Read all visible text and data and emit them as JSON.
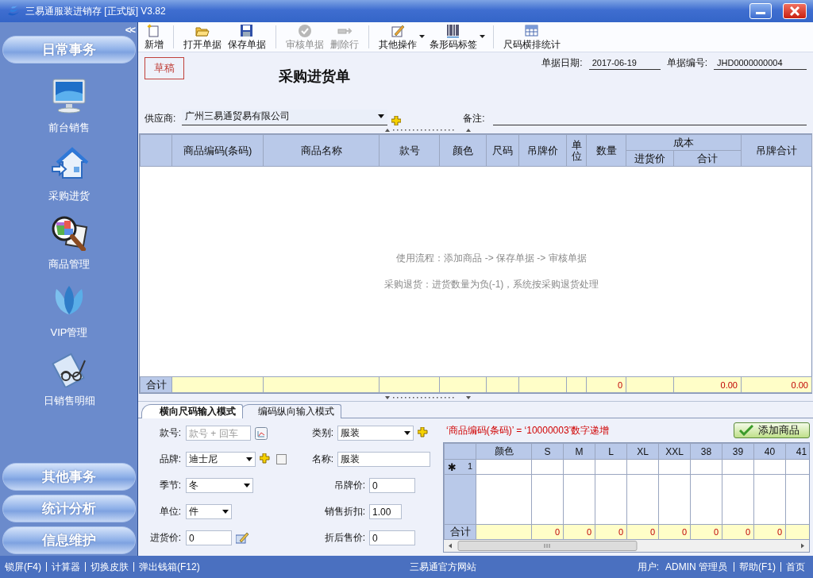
{
  "window": {
    "title": "三易通服装进销存 [正式版] V3.82"
  },
  "sidebar": {
    "collapse": "<<",
    "sections": [
      {
        "label": "日常事务",
        "items": [
          {
            "label": "前台销售",
            "kind": "monitor"
          },
          {
            "label": "采购进货",
            "kind": "house"
          },
          {
            "label": "商品管理",
            "kind": "magnifier"
          },
          {
            "label": "VIP管理",
            "kind": "petals"
          },
          {
            "label": "日销售明细",
            "kind": "notebook"
          }
        ]
      },
      {
        "label": "其他事务"
      },
      {
        "label": "统计分析"
      },
      {
        "label": "信息维护"
      }
    ]
  },
  "toolbar": {
    "groups": [
      [
        {
          "label": "新增",
          "kind": "new",
          "disabled": false,
          "dropdown": false
        }
      ],
      [
        {
          "label": "打开单据",
          "kind": "open",
          "disabled": false,
          "dropdown": false
        },
        {
          "label": "保存单据",
          "kind": "save",
          "disabled": false,
          "dropdown": false
        }
      ],
      [
        {
          "label": "审核单据",
          "kind": "approve",
          "disabled": true,
          "dropdown": false
        },
        {
          "label": "删除行",
          "kind": "delete",
          "disabled": true,
          "dropdown": false
        }
      ],
      [
        {
          "label": "其他操作",
          "kind": "edit",
          "disabled": false,
          "dropdown": true
        },
        {
          "label": "条形码标签",
          "kind": "barcode",
          "disabled": false,
          "dropdown": true
        }
      ],
      [
        {
          "label": "尺码横排统计",
          "kind": "grid",
          "disabled": false,
          "dropdown": false
        }
      ]
    ]
  },
  "document": {
    "stamp": "草稿",
    "title": "采购进货单",
    "date_label": "单据日期:",
    "date": "2017-06-19",
    "number_label": "单据编号:",
    "number": "JHD0000000004",
    "supplier_label": "供应商:",
    "supplier": "广州三易通贸易有限公司",
    "note_label": "备注:"
  },
  "table": {
    "columns": [
      {
        "label": "商品编码(条码)"
      },
      {
        "label": "商品名称"
      },
      {
        "label": "款号"
      },
      {
        "label": "颜色"
      },
      {
        "label": "尺码"
      },
      {
        "label": "吊牌价"
      },
      {
        "label": "单位"
      },
      {
        "label": "数量",
        "total": "0"
      },
      {
        "label": "成本",
        "children": [
          {
            "label": "进货价"
          },
          {
            "label": "合计",
            "total": "0.00"
          }
        ]
      },
      {
        "label": "吊牌合计",
        "total": "0.00"
      }
    ],
    "hints": [
      "使用流程：添加商品 -> 保存单据 -> 审核单据",
      "采购退货：进货数量为负(-1)，系统按采购退货处理"
    ],
    "total_label": "合计"
  },
  "entry_tabs": [
    {
      "label": "横向尺码输入模式",
      "selected": true
    },
    {
      "label": "编码纵向输入模式",
      "selected": false
    }
  ],
  "form": {
    "rows": [
      [
        {
          "label": "款号:",
          "kind": "text",
          "placeholder": "款号 + 回车",
          "extras": [
            {
              "kind": "picker"
            }
          ]
        },
        {
          "label": "类别:",
          "kind": "dropdown",
          "value": "服装",
          "extras": [
            {
              "kind": "add"
            }
          ]
        }
      ],
      [
        {
          "label": "品牌:",
          "kind": "dropdown",
          "value": "迪士尼",
          "extras": [
            {
              "kind": "add"
            },
            {
              "kind": "checkbox",
              "checked": false
            }
          ]
        },
        {
          "label": "名称:",
          "kind": "text",
          "value": "服装"
        }
      ],
      [
        {
          "label": "季节:",
          "kind": "dropdown",
          "value": "冬"
        },
        {
          "label": "吊牌价:",
          "kind": "text",
          "value": "0"
        }
      ],
      [
        {
          "label": "单位:",
          "kind": "dropdown",
          "value": "件"
        },
        {
          "label": "销售折扣:",
          "kind": "text",
          "value": "1.00"
        }
      ],
      [
        {
          "label": "进货价:",
          "kind": "text",
          "value": "0",
          "extras": [
            {
              "kind": "edit"
            }
          ]
        },
        {
          "label": "折后售价:",
          "kind": "text",
          "value": "0"
        }
      ]
    ]
  },
  "code_hint": "‘商品编码(条码)’ = ‘10000003’数字递增",
  "add_button": "添加商品",
  "size_grid": {
    "columns": [
      {
        "label": "颜色"
      },
      {
        "label": "S",
        "total": "0"
      },
      {
        "label": "M",
        "total": "0"
      },
      {
        "label": "L",
        "total": "0"
      },
      {
        "label": "XL",
        "total": "0"
      },
      {
        "label": "XXL",
        "total": "0"
      },
      {
        "label": "38",
        "total": "0"
      },
      {
        "label": "39",
        "total": "0"
      },
      {
        "label": "40",
        "total": "0"
      },
      {
        "label": "41"
      }
    ],
    "rows": [
      {
        "marker": "✱",
        "number": "1"
      }
    ],
    "total_label": "合计"
  },
  "status_bar": {
    "left": [
      "锁屏(F4)",
      "计算器",
      "切换皮肤",
      "弹出钱箱(F12)"
    ],
    "center": "三易通官方网站",
    "user_label": "用户:",
    "user": "ADMIN 管理员",
    "right": [
      "帮助(F1)",
      "首页"
    ]
  }
}
